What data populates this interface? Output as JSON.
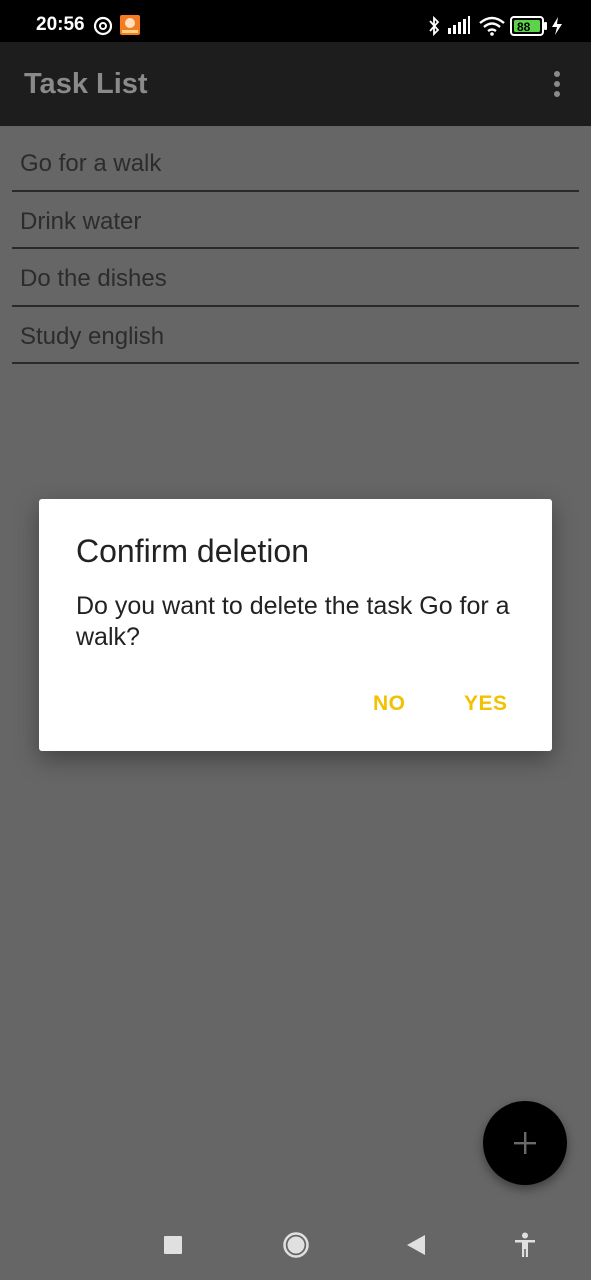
{
  "status_bar": {
    "time": "20:56",
    "battery": "88",
    "icons": [
      "at-sign-icon",
      "app-notification-icon",
      "bluetooth-icon",
      "signal-icon",
      "wifi-icon",
      "battery-icon",
      "charging-icon"
    ]
  },
  "app_bar": {
    "title": "Task List",
    "menu_icon": "more-vert-icon"
  },
  "tasks": [
    {
      "label": "Go for a walk"
    },
    {
      "label": "Drink water"
    },
    {
      "label": "Do the dishes"
    },
    {
      "label": "Study english"
    }
  ],
  "dialog": {
    "title": "Confirm deletion",
    "message": "Do you want to delete the task Go for a walk?",
    "negative_label": "NO",
    "positive_label": "YES"
  },
  "fab": {
    "icon": "add-icon"
  },
  "nav_bar": {
    "icons": [
      "recents-square-icon",
      "home-circle-icon",
      "back-triangle-icon",
      "accessibility-icon"
    ]
  },
  "colors": {
    "scrim": "#666666",
    "app_bar": "#1d1d1d",
    "accent": "#f2c100",
    "dialog_bg": "#ffffff"
  }
}
